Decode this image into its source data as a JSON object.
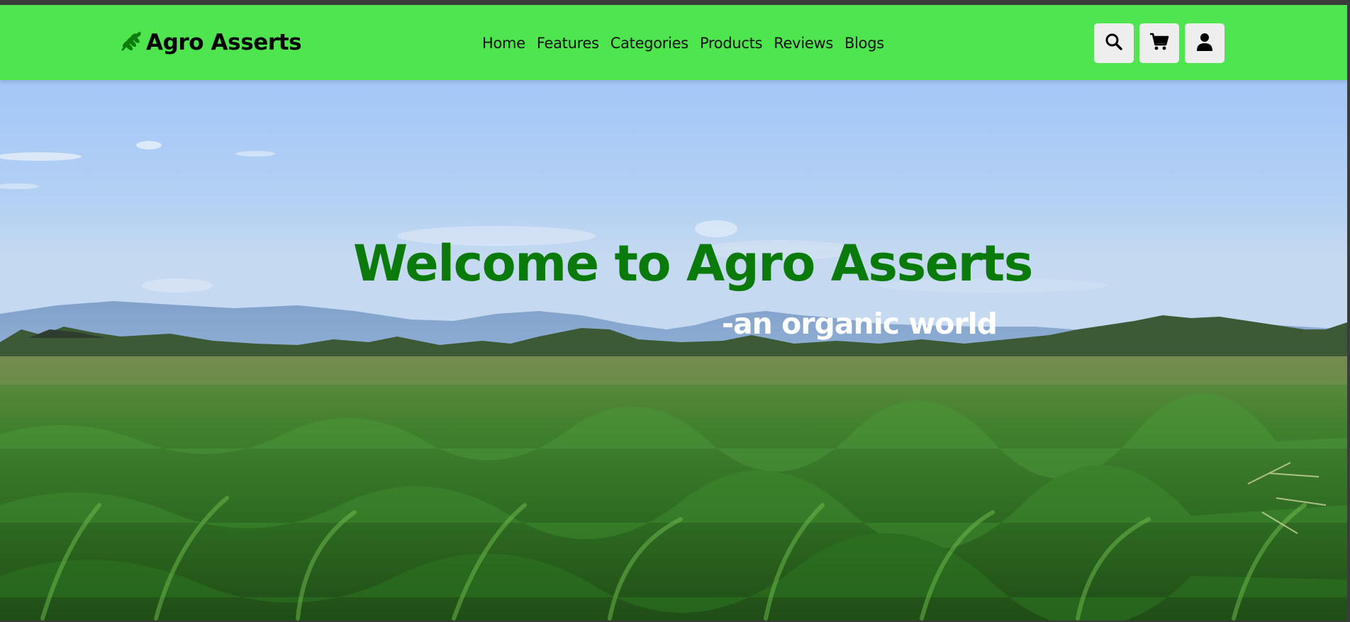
{
  "brand": {
    "name": "Agro Asserts",
    "icon": "leaf-icon"
  },
  "nav": {
    "items": [
      {
        "label": "Home"
      },
      {
        "label": "Features"
      },
      {
        "label": "Categories"
      },
      {
        "label": "Products"
      },
      {
        "label": "Reviews"
      },
      {
        "label": "Blogs"
      }
    ]
  },
  "header_icons": [
    "search-icon",
    "cart-icon",
    "user-icon"
  ],
  "hero": {
    "title": "Welcome to Agro Asserts",
    "subtitle": "-an organic world",
    "background": "corn-field-under-blue-sky"
  },
  "colors": {
    "header_bg": "#4ee54e",
    "title_green": "#0a7a0a",
    "subtitle_white": "#ffffff",
    "icon_button_bg": "#eeeeee"
  }
}
